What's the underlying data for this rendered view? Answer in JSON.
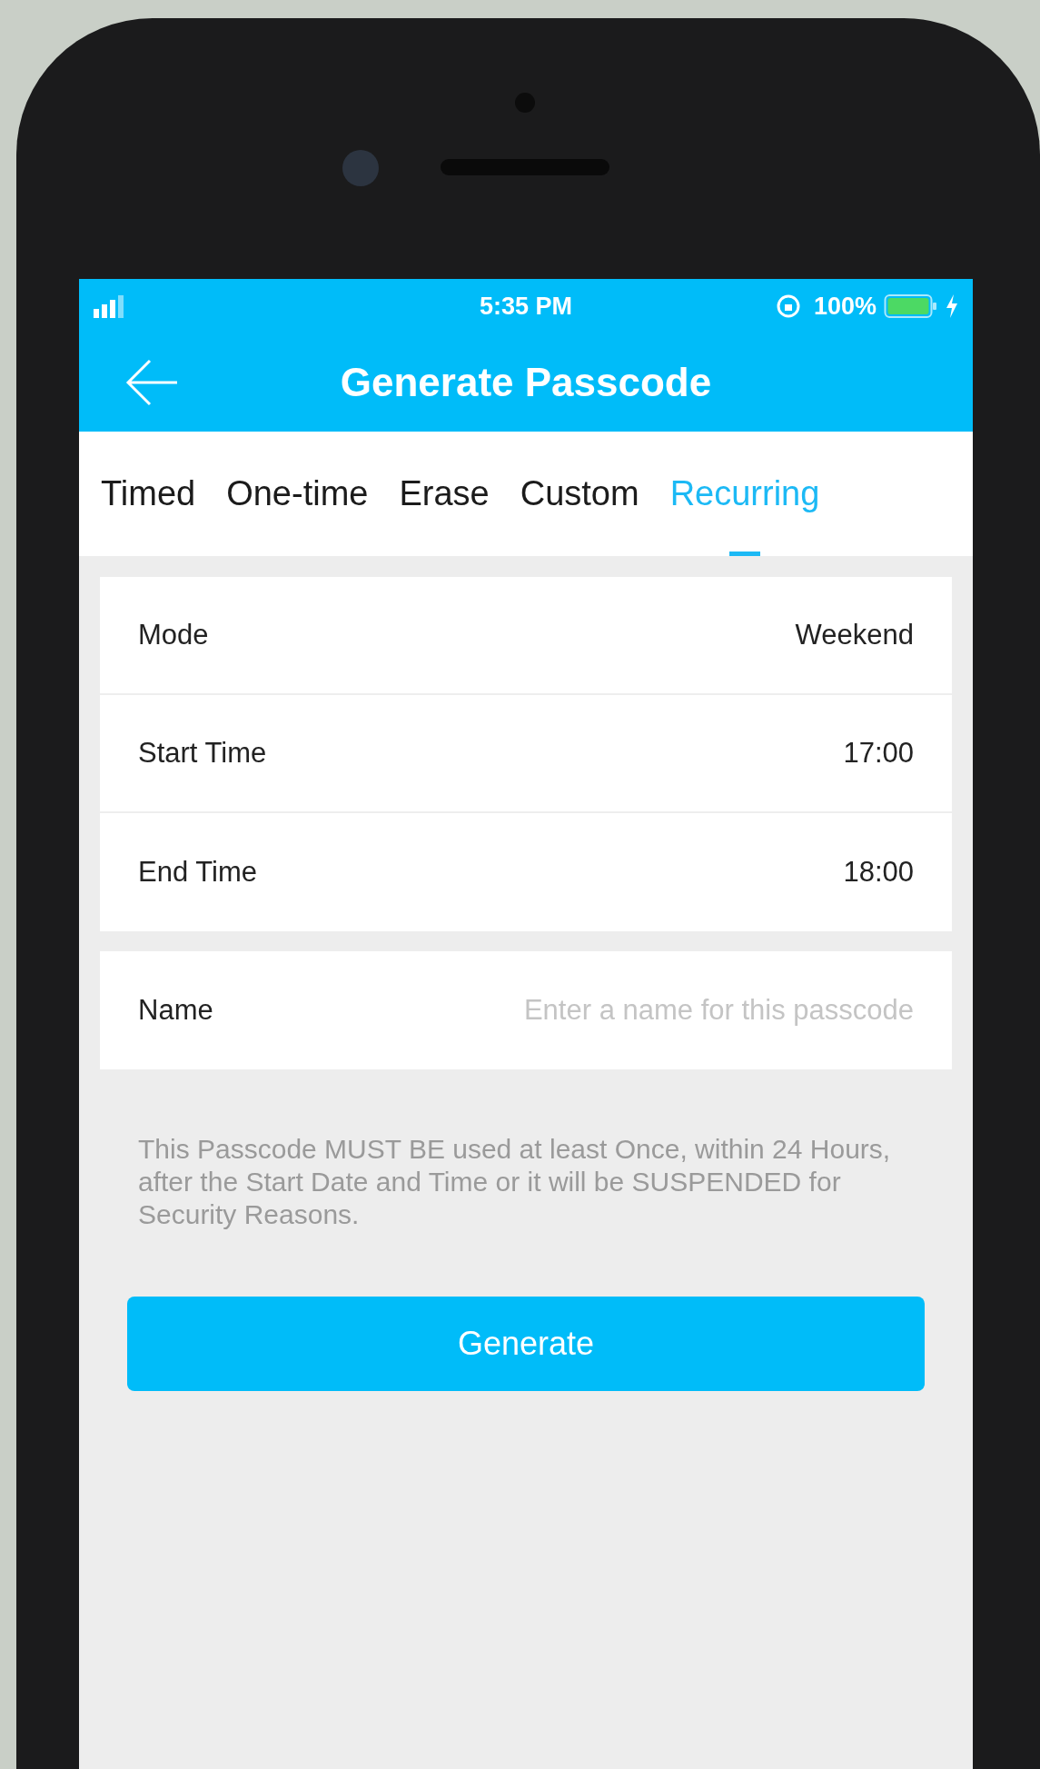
{
  "status_bar": {
    "time": "5:35 PM",
    "battery": "100%"
  },
  "header": {
    "title": "Generate Passcode"
  },
  "tabs": [
    {
      "label": "Timed",
      "selected": false
    },
    {
      "label": "One-time",
      "selected": false
    },
    {
      "label": "Erase",
      "selected": false
    },
    {
      "label": "Custom",
      "selected": false
    },
    {
      "label": "Recurring",
      "selected": true
    }
  ],
  "settings": [
    {
      "label": "Mode",
      "value": "Weekend"
    },
    {
      "label": "Start Time",
      "value": "17:00"
    },
    {
      "label": "End Time",
      "value": "18:00"
    }
  ],
  "name_field": {
    "label": "Name",
    "placeholder": "Enter a name for this passcode"
  },
  "notice": "This Passcode MUST BE used at least Once, within 24 Hours, after the Start Date and Time or it will be SUSPENDED for Security Reasons.",
  "button": "Generate"
}
